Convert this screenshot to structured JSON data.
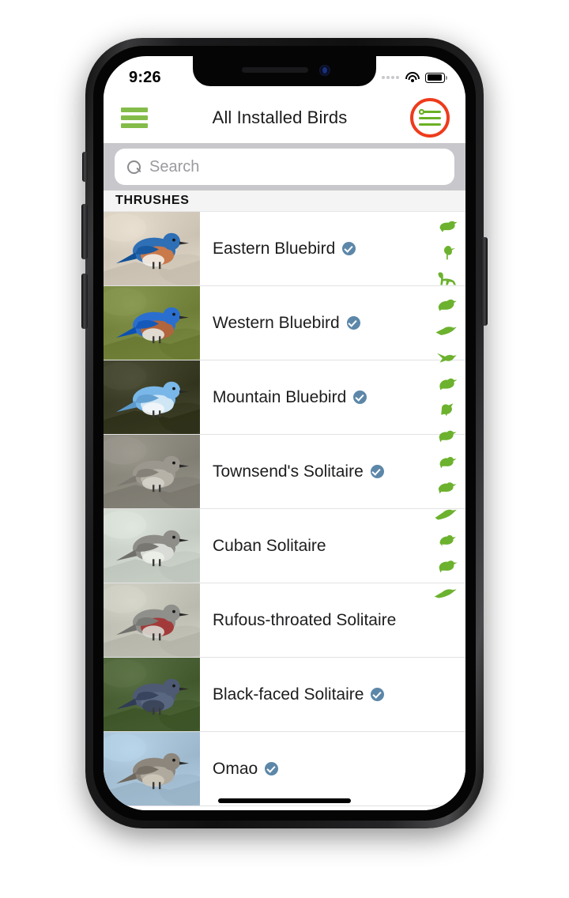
{
  "status_bar": {
    "time": "9:26",
    "cell_icon": "cell-signal-dots",
    "wifi_icon": "wifi-icon",
    "battery_icon": "battery-full-icon"
  },
  "nav": {
    "menu_icon": "hamburger-menu-icon",
    "title": "All Installed Birds",
    "filter_icon": "sliders-filter-icon",
    "filter_highlight_color": "#ee3b1c",
    "accent_green": "#84bc4a"
  },
  "search": {
    "placeholder": "Search",
    "value": "",
    "icon": "search-icon"
  },
  "section": {
    "header": "THRUSHES"
  },
  "list": {
    "rows": [
      {
        "name": "Eastern Bluebird",
        "installed": true,
        "thumb": "eastern-bluebird-photo",
        "thumb_bg": "#d8cfc0",
        "body": "#2f6fb5",
        "belly": "#c9794a",
        "under": "#f2efe9"
      },
      {
        "name": "Western Bluebird",
        "installed": true,
        "thumb": "western-bluebird-photo",
        "thumb_bg": "#7a8a42",
        "body": "#2a6fd0",
        "belly": "#b0653c",
        "under": "#e7e7e0"
      },
      {
        "name": "Mountain Bluebird",
        "installed": true,
        "thumb": "mountain-bluebird-photo",
        "thumb_bg": "#3e4029",
        "body": "#79b7e8",
        "belly": "#cfe6f5",
        "under": "#f2f6f8"
      },
      {
        "name": "Townsend's Solitaire",
        "installed": true,
        "thumb": "townsends-solitaire-photo",
        "thumb_bg": "#8d8a80",
        "body": "#9b978e",
        "belly": "#b6b2a8",
        "under": "#d5d2c9"
      },
      {
        "name": "Cuban Solitaire",
        "installed": false,
        "thumb": "cuban-solitaire-photo",
        "thumb_bg": "#cfd6cd",
        "body": "#8e8d88",
        "belly": "#d9dbd6",
        "under": "#eceee9"
      },
      {
        "name": "Rufous-throated Solitaire",
        "installed": false,
        "thumb": "rufous-throated-solitaire-photo",
        "thumb_bg": "#c6c6ba",
        "body": "#8f8f8b",
        "belly": "#a33a3a",
        "under": "#d8d8d2"
      },
      {
        "name": "Black-faced Solitaire",
        "installed": true,
        "thumb": "black-faced-solitaire-photo",
        "thumb_bg": "#4d6438",
        "body": "#4e5a73",
        "belly": "#5a6780",
        "under": "#384256"
      },
      {
        "name": "Omao",
        "installed": true,
        "thumb": "omao-photo",
        "thumb_bg": "#a9c4d8",
        "body": "#8d867c",
        "belly": "#b0a99d",
        "under": "#cfc9bd"
      }
    ]
  },
  "scroll_index": {
    "icon_color": "#6cb22e",
    "items": [
      "duck-silhouette-icon",
      "heron-silhouette-icon",
      "crane-silhouette-icon",
      "pigeon-silhouette-icon",
      "swift-silhouette-icon",
      "hummingbird-silhouette-icon",
      "kingfisher-silhouette-icon",
      "woodpecker-silhouette-icon",
      "sparrow-silhouette-icon",
      "finch-silhouette-icon",
      "warbler-silhouette-icon",
      "swallow-silhouette-icon",
      "wren-silhouette-icon",
      "thrush-silhouette-icon",
      "flycatcher-silhouette-icon"
    ]
  },
  "home_indicator": "home-indicator-bar"
}
